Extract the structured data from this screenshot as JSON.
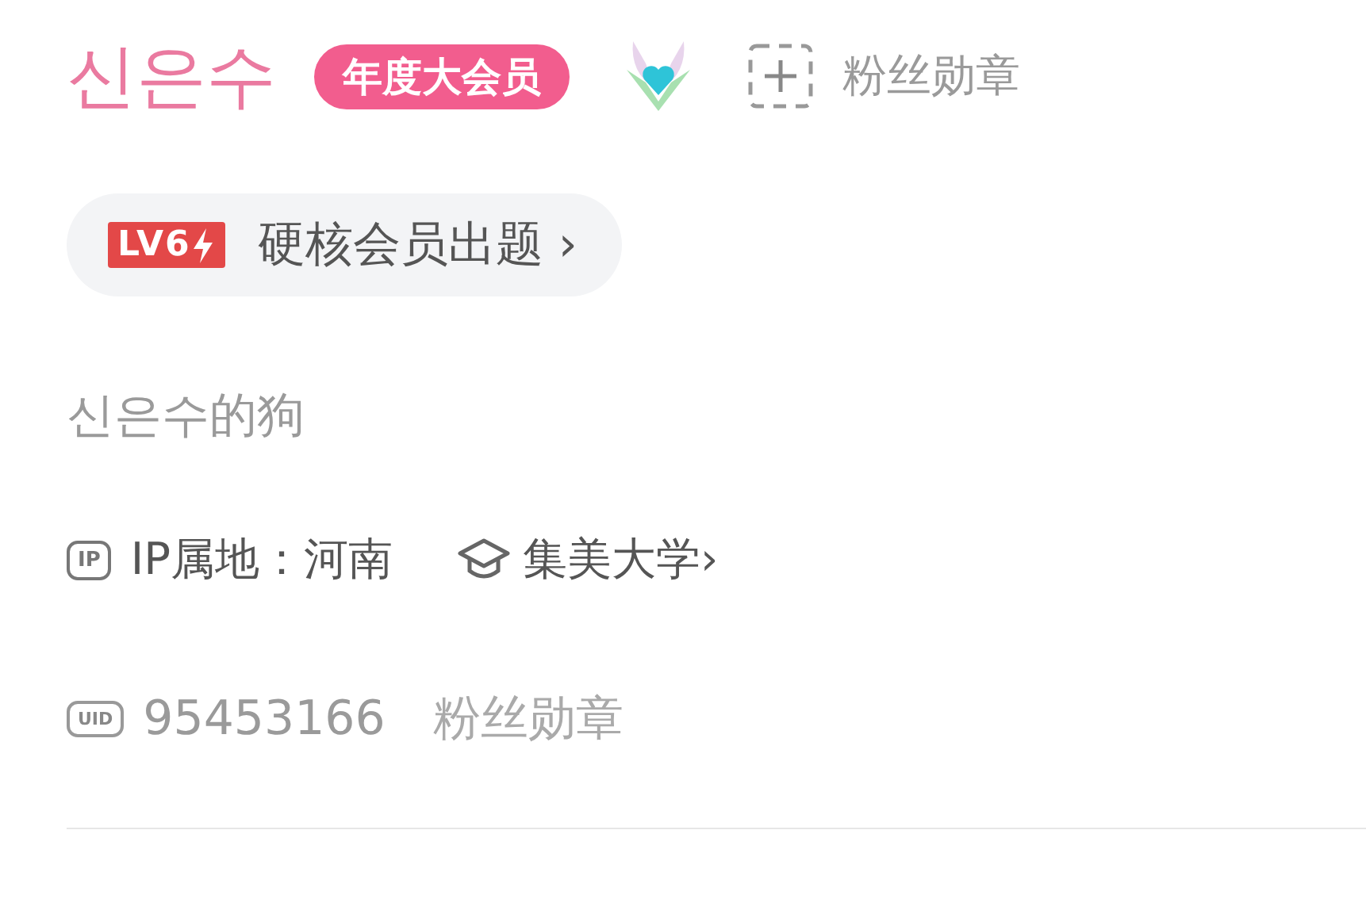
{
  "profile": {
    "name": "신은수",
    "vip_badge": "年度大会员",
    "medal_add": {
      "label": "粉丝勋章"
    },
    "level": {
      "badge": "LV6",
      "label": "硬核会员出题",
      "chevron": "›"
    },
    "signature": "신은수的狗",
    "ip": {
      "icon_text": "IP",
      "label": "IP属地：河南"
    },
    "school": {
      "label": "集美大学",
      "chevron": "›"
    },
    "uid": {
      "icon_text": "UID",
      "value": "95453166",
      "medal_label": "粉丝勋章"
    }
  }
}
